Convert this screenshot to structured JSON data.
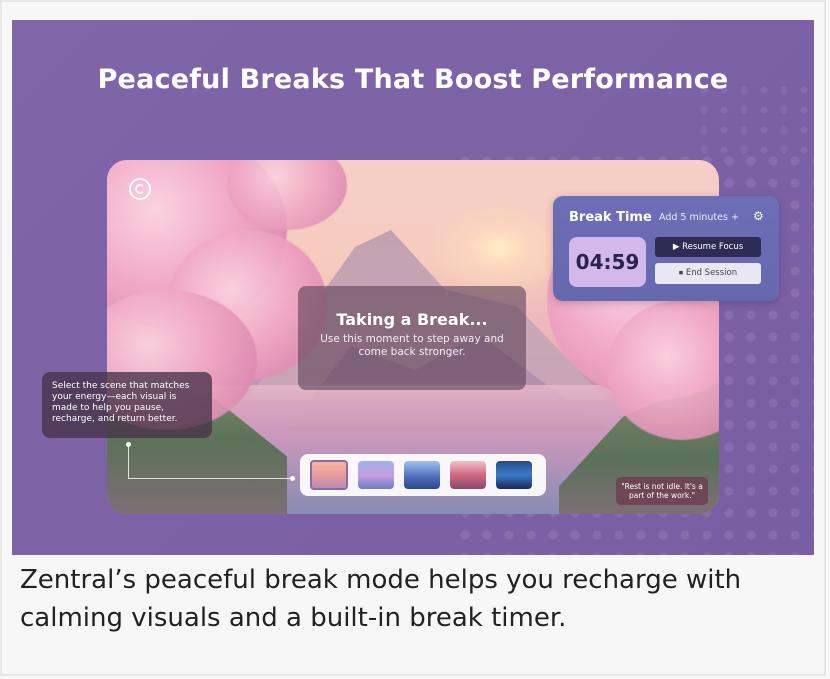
{
  "hero": {
    "title": "Peaceful Breaks That Boost Performance"
  },
  "scene": {
    "center_card": {
      "title": "Taking a Break...",
      "subtitle": "Use this moment to step away and come back stronger."
    },
    "side_card": {
      "text": "Select the scene that matches your energy—each visual is made to help you pause, recharge, and return better."
    },
    "thumbnails": [
      {
        "name": "sunset-lake",
        "selected": true
      },
      {
        "name": "waterfall"
      },
      {
        "name": "mountains"
      },
      {
        "name": "cherry-blossom"
      },
      {
        "name": "city-night"
      }
    ],
    "quote": "\"Rest is not idle. It's a part of the work.\""
  },
  "timer": {
    "title": "Break Time",
    "add_label": "Add 5 minutes +",
    "time": "04:59",
    "resume_label": "Resume Focus",
    "end_label": "End Session",
    "icons": {
      "settings": "gear-icon",
      "resume": "play-icon",
      "end": "stop-icon"
    }
  },
  "caption": "Zentral’s peaceful break mode helps you recharge with calming visuals and a built-in break timer.",
  "colors": {
    "hero_bg": "#7d61a6",
    "timer_card": "#6d6eb6",
    "timer_clock": "#d3b8ec",
    "resume_button": "#2e2c54",
    "end_button": "#e9e8f2"
  }
}
